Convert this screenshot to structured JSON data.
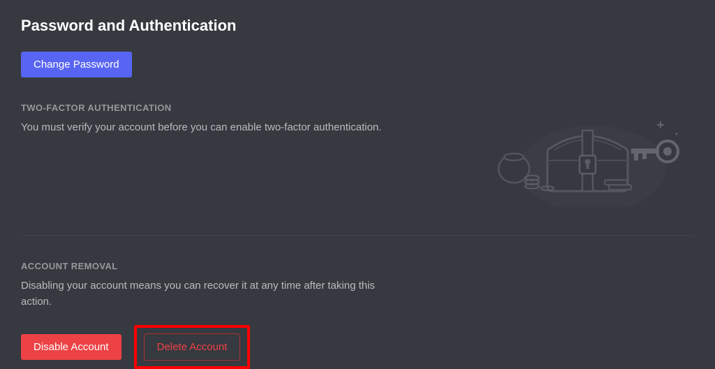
{
  "header": {
    "title": "Password and Authentication"
  },
  "actions": {
    "change_password": "Change Password"
  },
  "twofa": {
    "header": "TWO-FACTOR AUTHENTICATION",
    "desc": "You must verify your account before you can enable two-factor authentication."
  },
  "removal": {
    "header": "ACCOUNT REMOVAL",
    "desc": "Disabling your account means you can recover it at any time after taking this action.",
    "disable_label": "Disable Account",
    "delete_label": "Delete Account"
  }
}
